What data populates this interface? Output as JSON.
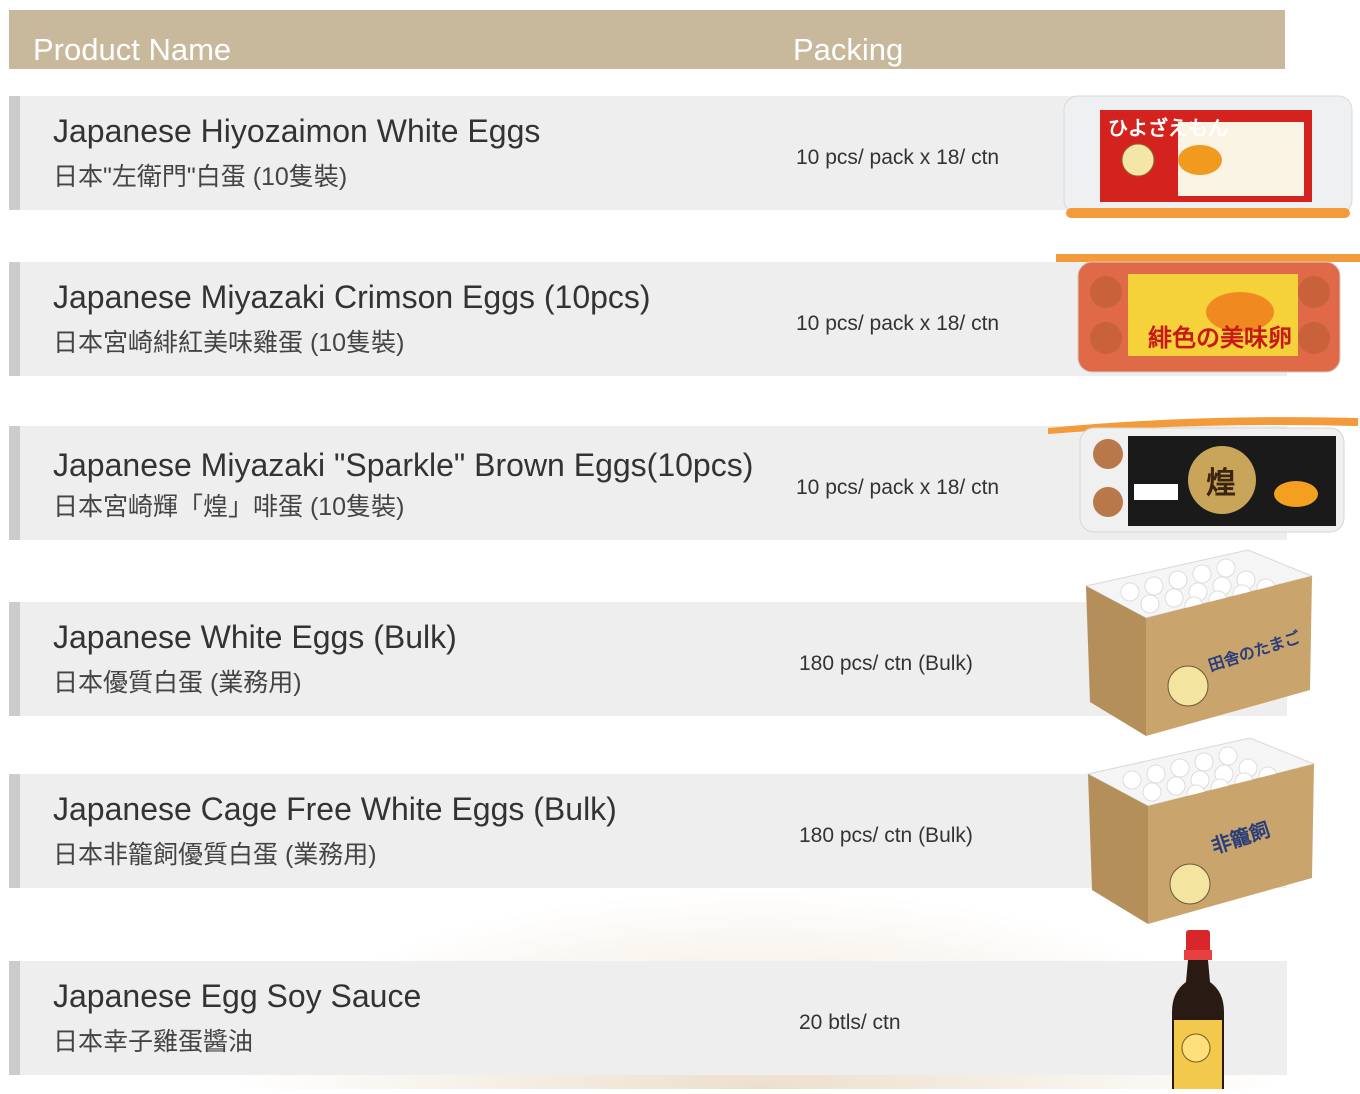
{
  "header": {
    "product_name": "Product Name",
    "packing": "Packing"
  },
  "products": [
    {
      "name_en": "Japanese Hiyozaimon White Eggs",
      "name_zh": "日本\"左衛門\"白蛋 (10隻裝)",
      "packing": "10 pcs/ pack x 18/ ctn",
      "label": "ひよざえもん"
    },
    {
      "name_en": "Japanese Miyazaki Crimson Eggs  (10pcs)",
      "name_zh": "日本宮崎緋紅美味雞蛋 (10隻裝)",
      "packing": "10 pcs/ pack x 18/ ctn",
      "label": "緋色の美味卵"
    },
    {
      "name_en": "Japanese Miyazaki \"Sparkle\" Brown Eggs(10pcs)",
      "name_zh": "日本宮崎輝「煌」啡蛋 (10隻裝)",
      "packing": "10 pcs/ pack x 18/ ctn",
      "label": "煌"
    },
    {
      "name_en": "Japanese White Eggs (Bulk)",
      "name_zh": "日本優質白蛋 (業務用)",
      "packing": "180 pcs/ ctn (Bulk)",
      "label": "田舎のたまご"
    },
    {
      "name_en": "Japanese Cage Free White Eggs (Bulk)",
      "name_zh": "日本非籠飼優質白蛋 (業務用)",
      "packing": "180 pcs/ ctn (Bulk)",
      "label": "非籠飼"
    },
    {
      "name_en": "Japanese Egg Soy Sauce",
      "name_zh": "日本幸子雞蛋醬油",
      "packing": "20 btls/ ctn",
      "label": ""
    }
  ],
  "colors": {
    "header_bg": "#c8b99c",
    "row_bg": "#eeeeee",
    "accent_bar": "#cccccc"
  }
}
